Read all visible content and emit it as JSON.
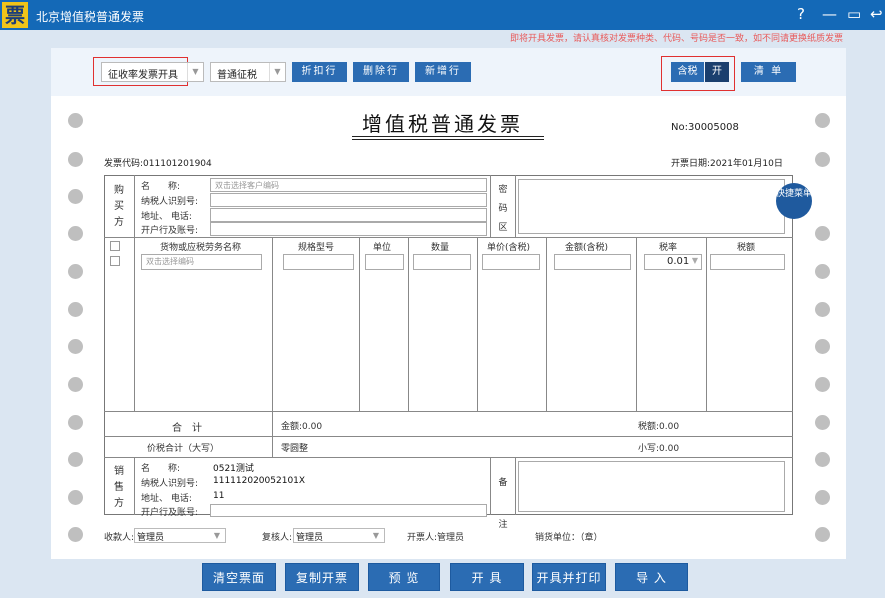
{
  "window": {
    "title": "北京增值税普通发票",
    "logo": "票",
    "controls": [
      "?",
      "—",
      "▭",
      "↩"
    ]
  },
  "notice": "即将开具发票，请认真核对发票种类、代码、号码是否一致，如不同请更换纸质发票",
  "toolbar": {
    "invoice_mode": "征收率发票开具",
    "tax_type": "普通征税",
    "discount_btn": "折扣行",
    "delete_btn": "删除行",
    "add_btn": "新增行",
    "tax_incl": "含税",
    "tax_toggle": "开",
    "list_btn": "清 单"
  },
  "invoice": {
    "title": "增值税普通发票",
    "no_label": "No:",
    "no": "30005008",
    "code_label": "发票代码:",
    "code": "011101201904",
    "date_label": "开票日期:",
    "date": "2021年01月10日",
    "buyer": {
      "section": "购买方",
      "name_label": "名　　称:",
      "name_ph": "双击选择客户编码",
      "taxid_label": "纳税人识别号:",
      "addr_label": "地址、 电话:",
      "bank_label": "开户行及账号:",
      "mi": "密码区"
    },
    "items": {
      "headers": [
        "货物或应税劳务名称",
        "规格型号",
        "单位",
        "数量",
        "单价(含税)",
        "金额(含税)",
        "税率",
        "税额"
      ],
      "code_ph": "双击选择编码",
      "rate": "0.01"
    },
    "total": {
      "label": "合　计",
      "amount_label": "金额:",
      "amount": "0.00",
      "tax_label": "税额:",
      "tax": "0.00"
    },
    "grand": {
      "label": "价税合计（大写）",
      "big": "零圆整",
      "small_label": "小写:",
      "small": "0.00"
    },
    "seller": {
      "section": "销售方",
      "name_label": "名　　称:",
      "name": "0521测试",
      "taxid_label": "纳税人识别号:",
      "taxid": "111112020052101X",
      "addr_label": "地址、 电话:",
      "addr": "11",
      "bank_label": "开户行及账号:",
      "note": "备注"
    },
    "footer": {
      "payee_label": "收款人:",
      "payee": "管理员",
      "reviewer_label": "复核人:",
      "reviewer": "管理员",
      "issuer_label": "开票人:",
      "issuer": "管理员",
      "seal": "销货单位：（章）"
    }
  },
  "quick_menu": "快捷菜单",
  "buttons": [
    "清空票面",
    "复制开票",
    "预 览",
    "开 具",
    "开具并打印",
    "导 入"
  ]
}
